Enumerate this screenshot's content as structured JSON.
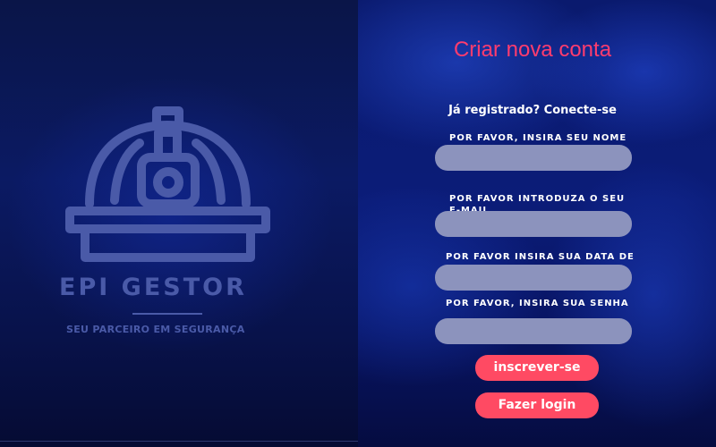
{
  "brand": {
    "name": "EPI GESTOR",
    "tagline": "SEU PARCEIRO EM SEGURANÇA",
    "logo_icon": "hard-hat-icon",
    "logo_color": "#4a5aa8"
  },
  "form": {
    "title": "Criar nova conta",
    "login_prompt": "Já registrado? Conecte-se",
    "fields": [
      {
        "label": "POR FAVOR, INSIRA SEU NOME",
        "value": "",
        "placeholder": ""
      },
      {
        "label": "POR FAVOR INTRODUZA O SEU\nE-MAIL",
        "value": "",
        "placeholder": ""
      },
      {
        "label": "POR FAVOR INSIRA SUA DATA DE\nNASCIMENTO",
        "value": "",
        "placeholder": ""
      },
      {
        "label": "POR FAVOR, INSIRA SUA SENHA",
        "value": "",
        "placeholder": ""
      }
    ],
    "buttons": {
      "signup": "inscrever-se",
      "login": "Fazer login"
    }
  },
  "colors": {
    "accent": "#ff4a63",
    "title": "#ff3c6e",
    "input_bg": "#8c93bd",
    "background": "#0b1c78"
  }
}
